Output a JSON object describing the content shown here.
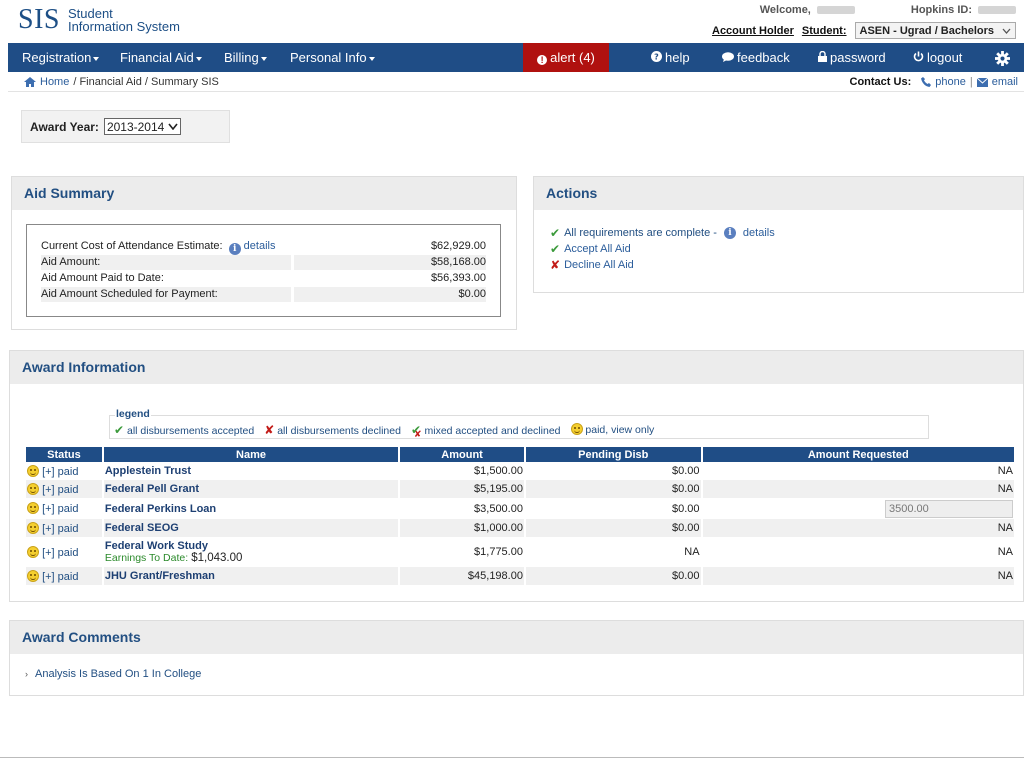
{
  "header": {
    "logo_mark": "SIS",
    "logo_line1": "Student",
    "logo_line2": "Information System",
    "welcome_label": "Welcome,",
    "hopkins_id_label": "Hopkins ID:",
    "account_holder_link": "Account Holder",
    "student_label": "Student:",
    "student_value": "ASEN - Ugrad / Bachelors"
  },
  "nav": {
    "registration": "Registration",
    "financial_aid": "Financial Aid",
    "billing": "Billing",
    "personal_info": "Personal Info",
    "alert": "alert (4)",
    "help": "help",
    "feedback": "feedback",
    "password": "password",
    "logout": "logout",
    "alert_color": "#b0110f",
    "bar_color": "#1f4d86"
  },
  "breadcrumb": {
    "home": "Home",
    "rest": "/ Financial Aid / Summary SIS"
  },
  "contact": {
    "label": "Contact Us:",
    "phone": "phone",
    "divider": "|",
    "email": "email"
  },
  "award_year": {
    "label": "Award Year:",
    "value": "2013-2014"
  },
  "aid_summary": {
    "title": "Aid Summary",
    "details_link": "details",
    "rows": [
      {
        "label": "Current Cost of Attendance Estimate:",
        "value": "$62,929.00"
      },
      {
        "label": "Aid Amount:",
        "value": "$58,168.00"
      },
      {
        "label": "Aid Amount Paid to Date:",
        "value": "$56,393.00"
      },
      {
        "label": "Aid Amount Scheduled for Payment:",
        "value": "$0.00"
      }
    ]
  },
  "actions": {
    "title": "Actions",
    "requirements": "All requirements are complete -",
    "details_link": "details",
    "accept_all": "Accept All Aid",
    "decline_all": "Decline All Aid"
  },
  "award_info": {
    "title": "Award Information",
    "legend": {
      "title": "legend",
      "accepted": "all disbursements accepted",
      "declined": "all disbursements declined",
      "mixed": "mixed accepted and declined",
      "paid": "paid, view only"
    },
    "columns": [
      "Status",
      "Name",
      "Amount",
      "Pending Disb",
      "Amount Requested"
    ],
    "rows": [
      {
        "status": "[+] paid",
        "name": "Applestein Trust",
        "amount": "$1,500.00",
        "pending": "$0.00",
        "requested": "NA"
      },
      {
        "status": "[+] paid",
        "name": "Federal Pell Grant",
        "amount": "$5,195.00",
        "pending": "$0.00",
        "requested": "NA"
      },
      {
        "status": "[+] paid",
        "name": "Federal Perkins Loan",
        "amount": "$3,500.00",
        "pending": "$0.00",
        "requested": "3500.00"
      },
      {
        "status": "[+] paid",
        "name": "Federal SEOG",
        "amount": "$1,000.00",
        "pending": "$0.00",
        "requested": "NA"
      },
      {
        "status": "[+] paid",
        "name": "Federal Work Study",
        "earnings_label": "Earnings To Date:",
        "earnings_value": "$1,043.00",
        "amount": "$1,775.00",
        "pending": "NA",
        "requested": "NA"
      },
      {
        "status": "[+] paid",
        "name": "JHU Grant/Freshman",
        "amount": "$45,198.00",
        "pending": "$0.00",
        "requested": "NA"
      }
    ]
  },
  "award_comments": {
    "title": "Award Comments",
    "items": [
      "Analysis Is Based On 1 In College"
    ]
  }
}
